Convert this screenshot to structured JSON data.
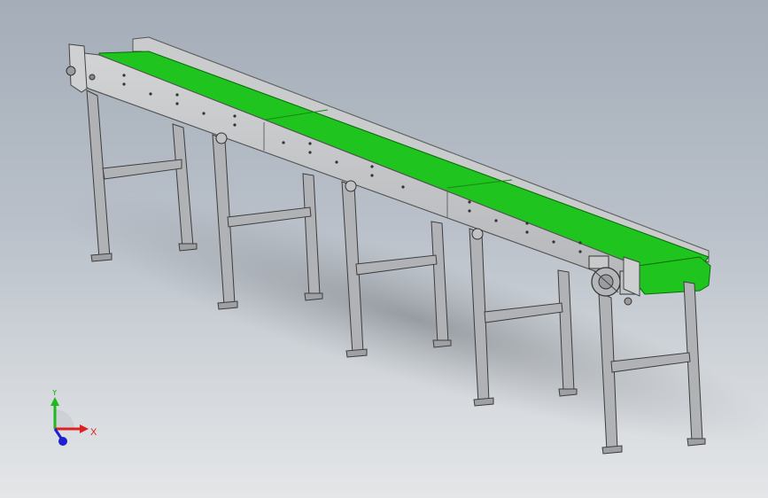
{
  "viewport": {
    "background_top": "#a4adb8",
    "background_bottom": "#e4e6e8"
  },
  "model": {
    "belt_color": "#1fc41f",
    "frame_color": "#c6c8cb",
    "leg_color": "#aeb0b3"
  },
  "triad": {
    "x_label": "X",
    "y_label": "Y",
    "x_color": "#e02020",
    "y_color": "#1fb81f",
    "z_color": "#2020d0"
  }
}
